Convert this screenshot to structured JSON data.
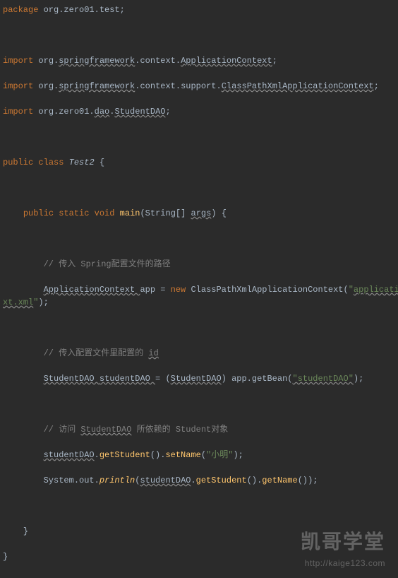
{
  "code": {
    "l1_kw": "package ",
    "l1_pkg": "org.zero01.test;",
    "l3_kw": "import ",
    "l3_a": "org.",
    "l3_b": "springframework",
    "l3_c": ".context.",
    "l3_d": "ApplicationContext",
    "l3_e": ";",
    "l4_kw": "import ",
    "l4_a": "org.",
    "l4_b": "springframework",
    "l4_c": ".context.support.",
    "l4_d": "ClassPathXmlApplicationContext",
    "l4_e": ";",
    "l5_kw": "import ",
    "l5_a": "org.zero01.",
    "l5_b": "dao",
    "l5_c": ".",
    "l5_d": "StudentDAO",
    "l5_e": ";",
    "l7_kw1": "public ",
    "l7_kw2": "class ",
    "l7_cls": "Test2 ",
    "l7_brace": "{",
    "l9_indent": "    ",
    "l9_kw1": "public ",
    "l9_kw2": "static ",
    "l9_kw3": "void ",
    "l9_method": "main",
    "l9_params": "(String[] ",
    "l9_args": "args",
    "l9_end": ") {",
    "l11_indent": "        ",
    "l11_comment": "// 传入 Spring配置文件的路径",
    "l12_indent": "        ",
    "l12_type": "ApplicationContext ",
    "l12_var": "app = ",
    "l12_new": "new ",
    "l12_ctor": "ClassPathXmlApplicationContext(",
    "l12_str1": "\"",
    "l12_str2": "applicationConte",
    "l13_str": "xt.xml",
    "l13_strend": "\"",
    "l13_end": ");",
    "l15_indent": "        ",
    "l15_comment_a": "// 传入配置文件里配置的 ",
    "l15_comment_b": "id",
    "l16_indent": "        ",
    "l16_type": "StudentDAO ",
    "l16_var": "studentDAO ",
    "l16_eq": "= (",
    "l16_cast": "StudentDAO",
    "l16_mid": ") app.getBean(",
    "l16_str": "\"studentDAO\"",
    "l16_end": ");",
    "l18_indent": "        ",
    "l18_comment_a": "// 访问 ",
    "l18_comment_b": "StudentDAO",
    "l18_comment_c": " 所依赖的 Student对象",
    "l19_indent": "        ",
    "l19_var": "studentDAO",
    "l19_a": ".",
    "l19_m1": "getStudent",
    "l19_b": "().",
    "l19_m2": "setName",
    "l19_c": "(",
    "l19_str": "\"小明\"",
    "l19_end": ");",
    "l20_indent": "        ",
    "l20_a": "System.out.",
    "l20_m1": "println",
    "l20_b": "(",
    "l20_var": "studentDAO",
    "l20_c": ".",
    "l20_m2": "getStudent",
    "l20_d": "().",
    "l20_m3": "getName",
    "l20_e": "());",
    "l22_indent": "    ",
    "l22_brace": "}",
    "l23_brace": "}"
  },
  "watermark": {
    "cn": "凯哥学堂",
    "url": "http://kaige123.com"
  }
}
